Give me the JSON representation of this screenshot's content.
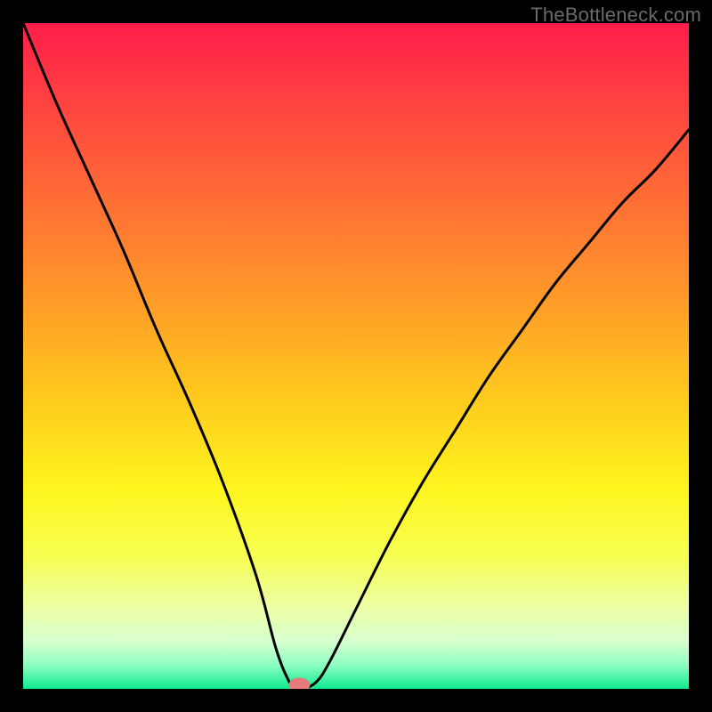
{
  "watermark": "TheBottleneck.com",
  "chart_data": {
    "type": "line",
    "title": "",
    "xlabel": "",
    "ylabel": "",
    "xlim": [
      0,
      100
    ],
    "ylim": [
      0,
      100
    ],
    "grid": false,
    "series": [
      {
        "name": "curve",
        "x": [
          0,
          5,
          10,
          15,
          20,
          25,
          30,
          35,
          38,
          40,
          41,
          42,
          44,
          46,
          50,
          55,
          60,
          65,
          70,
          75,
          80,
          85,
          90,
          95,
          100
        ],
        "values": [
          100,
          88,
          77,
          66,
          54,
          43,
          31,
          17,
          6,
          1,
          0,
          0,
          1,
          4,
          12,
          22,
          31,
          39,
          47,
          54,
          61,
          67,
          73,
          78,
          84
        ]
      }
    ],
    "marker": {
      "x": 41.5,
      "y": 0.6
    },
    "gradient_stops": [
      {
        "offset": 0.0,
        "color": "#ff1e4a"
      },
      {
        "offset": 0.2,
        "color": "#ff5a3a"
      },
      {
        "offset": 0.4,
        "color": "#ff962a"
      },
      {
        "offset": 0.55,
        "color": "#ffc61d"
      },
      {
        "offset": 0.7,
        "color": "#fff51e"
      },
      {
        "offset": 0.8,
        "color": "#f7ff52"
      },
      {
        "offset": 0.88,
        "color": "#ecffa8"
      },
      {
        "offset": 0.93,
        "color": "#d6ffd0"
      },
      {
        "offset": 0.965,
        "color": "#8bffc0"
      },
      {
        "offset": 1.0,
        "color": "#10e890"
      }
    ]
  }
}
